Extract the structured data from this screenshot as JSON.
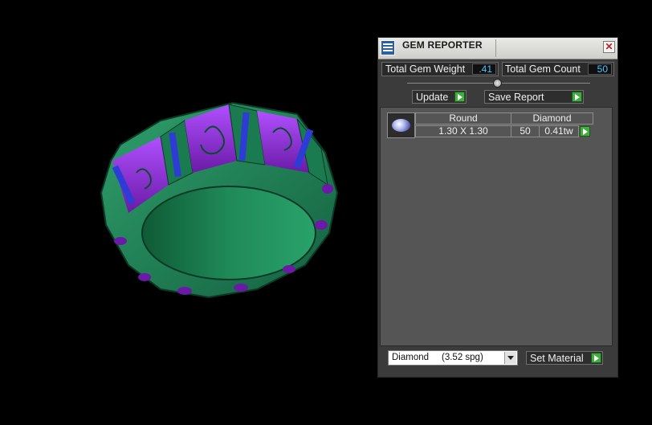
{
  "window": {
    "title": "GEM REPORTER",
    "icon": "gem-report-icon",
    "close_glyph": "✕"
  },
  "stats": {
    "total_gem_weight_label": "Total Gem Weight",
    "total_gem_weight_value": ".41",
    "total_gem_count_label": "Total Gem Count",
    "total_gem_count_value": "50"
  },
  "buttons": {
    "update": "Update",
    "save_report": "Save Report",
    "set_material": "Set Material"
  },
  "gem_rows": [
    {
      "shape": "Round",
      "size": "1.30 X 1.30",
      "material": "Diamond",
      "count": "50",
      "weight": "0.41tw"
    }
  ],
  "material_select": {
    "value": "Diamond     (3.52 spg)"
  },
  "colors": {
    "accent_green": "#3fae3f",
    "value_text": "#4fc3ff",
    "ring_body": "#1f8a5c",
    "ring_accent": "#8a2fc8",
    "gems": "#2e3bd6"
  }
}
